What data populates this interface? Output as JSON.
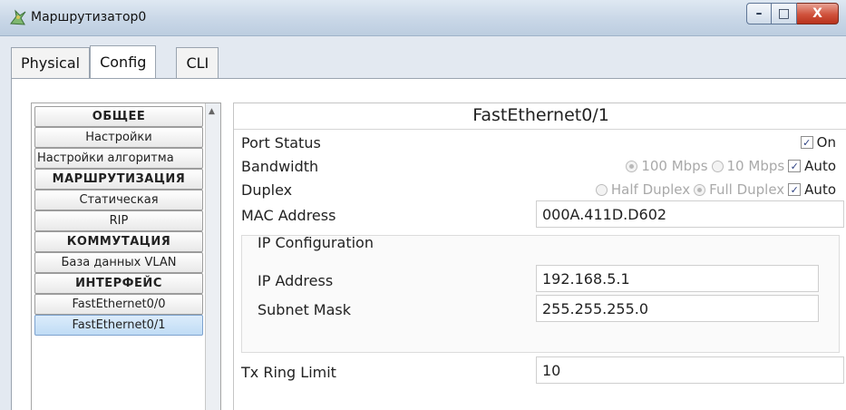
{
  "window": {
    "title": "Маршрутизатор0",
    "buttons": {
      "minimize": "–",
      "maximize": "□",
      "close": "X"
    }
  },
  "tabs": [
    {
      "label": "Physical",
      "active": false
    },
    {
      "label": "Config",
      "active": true
    },
    {
      "label": "CLI",
      "active": false
    }
  ],
  "nav": {
    "items": [
      {
        "label": "ОБЩЕЕ",
        "kind": "header"
      },
      {
        "label": "Настройки",
        "kind": "item"
      },
      {
        "label": "Настройки алгоритма",
        "kind": "item"
      },
      {
        "label": "МАРШРУТИЗАЦИЯ",
        "kind": "header"
      },
      {
        "label": "Статическая",
        "kind": "item"
      },
      {
        "label": "RIP",
        "kind": "item"
      },
      {
        "label": "КОММУТАЦИЯ",
        "kind": "header"
      },
      {
        "label": "База данных VLAN",
        "kind": "item"
      },
      {
        "label": "ИНТЕРФЕЙС",
        "kind": "header"
      },
      {
        "label": "FastEthernet0/0",
        "kind": "item"
      },
      {
        "label": "FastEthernet0/1",
        "kind": "item",
        "selected": true
      }
    ]
  },
  "panel": {
    "title": "FastEthernet0/1",
    "port_status": {
      "label": "Port Status",
      "on_label": "On",
      "checked": true
    },
    "bandwidth": {
      "label": "Bandwidth",
      "opt1": "100 Mbps",
      "opt2": "10 Mbps",
      "auto": "Auto",
      "selected": "100 Mbps",
      "auto_checked": true
    },
    "duplex": {
      "label": "Duplex",
      "opt1": "Half Duplex",
      "opt2": "Full Duplex",
      "auto": "Auto",
      "selected": "Full Duplex",
      "auto_checked": true
    },
    "mac": {
      "label": "MAC Address",
      "value": "000A.411D.D602"
    },
    "ip_config": {
      "label": "IP Configuration",
      "ip": {
        "label": "IP Address",
        "value": "192.168.5.1"
      },
      "mask": {
        "label": "Subnet Mask",
        "value": "255.255.255.0"
      }
    },
    "tx": {
      "label": "Tx Ring Limit",
      "value": "10"
    }
  }
}
